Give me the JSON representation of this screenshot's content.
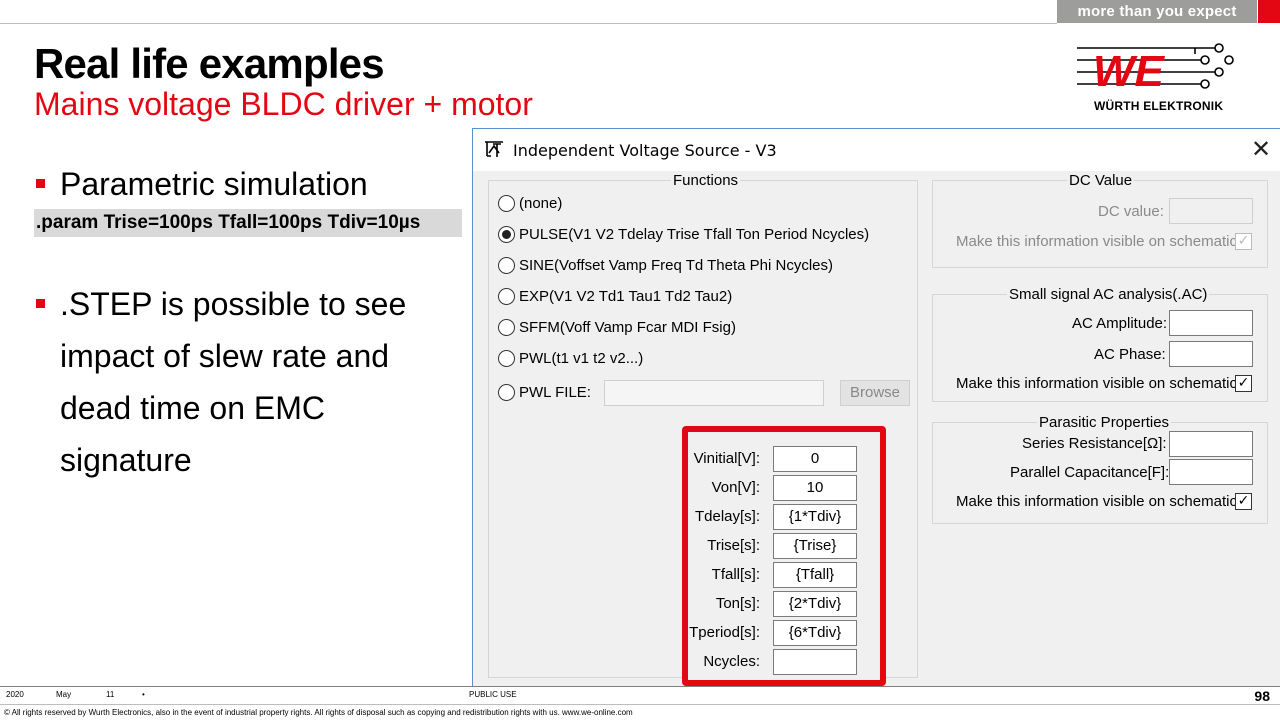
{
  "header": {
    "tagline": "more than you expect",
    "title": "Real life examples",
    "subtitle": "Mains voltage BLDC driver + motor",
    "logo_text": "WÜRTH ELEKTRONIK",
    "logo_letters": "WE",
    "brand_color": "#e30613"
  },
  "bullets": {
    "b1": "Parametric simulation",
    "param_line": ".param Trise=100ps Tfall=100ps Tdiv=10µs",
    "b2_lines": [
      "STEP is possible to see",
      "impact of slew rate and",
      "dead time on EMC",
      "signature"
    ],
    "b2_l1": ".STEP is possible to see",
    "b2_l2": "impact of slew rate and",
    "b2_l3": "dead time on EMC",
    "b2_l4": "signature"
  },
  "dialog": {
    "title": "Independent Voltage Source - V3",
    "functions": {
      "label": "Functions",
      "options": [
        "(none)",
        "PULSE(V1 V2 Tdelay Trise Tfall Ton Period Ncycles)",
        "SINE(Voffset Vamp Freq Td Theta Phi Ncycles)",
        "EXP(V1 V2 Td1 Tau1 Td2 Tau2)",
        "SFFM(Voff Vamp Fcar MDI Fsig)",
        "PWL(t1 v1 t2 v2...)",
        "PWL FILE:"
      ],
      "selected": "PULSE(V1 V2 Tdelay Trise Tfall Ton Period Ncycles)",
      "browse": "Browse"
    },
    "params": [
      {
        "label": "Vinitial[V]:",
        "value": "0"
      },
      {
        "label": "Von[V]:",
        "value": "10"
      },
      {
        "label": "Tdelay[s]:",
        "value": "{1*Tdiv}"
      },
      {
        "label": "Trise[s]:",
        "value": "{Trise}"
      },
      {
        "label": "Tfall[s]:",
        "value": "{Tfall}"
      },
      {
        "label": "Ton[s]:",
        "value": "{2*Tdiv}"
      },
      {
        "label": "Tperiod[s]:",
        "value": "{6*Tdiv}"
      },
      {
        "label": "Ncycles:",
        "value": ""
      }
    ],
    "dc": {
      "label": "DC Value",
      "dc_value_label": "DC value:",
      "visible_label": "Make this information visible on schematic:",
      "checked": true
    },
    "ac": {
      "label": "Small signal AC analysis(.AC)",
      "amplitude_label": "AC Amplitude:",
      "phase_label": "AC Phase:",
      "visible_label": "Make this information visible on schematic:",
      "checked": true
    },
    "parasitic": {
      "label": "Parasitic Properties",
      "series_label": "Series Resistance[Ω]:",
      "parallel_label": "Parallel Capacitance[F]:",
      "visible_label": "Make this information visible on schematic:",
      "checked": true
    }
  },
  "footer": {
    "year": "2020",
    "month": "May",
    "day": "11",
    "dot": "•",
    "classification": "PUBLIC USE",
    "page": "98",
    "copyright": "© All rights reserved by Wurth Electronics, also in the event of industrial property rights. All rights of disposal such as copying and redistribution rights with us. www.we-online.com"
  }
}
